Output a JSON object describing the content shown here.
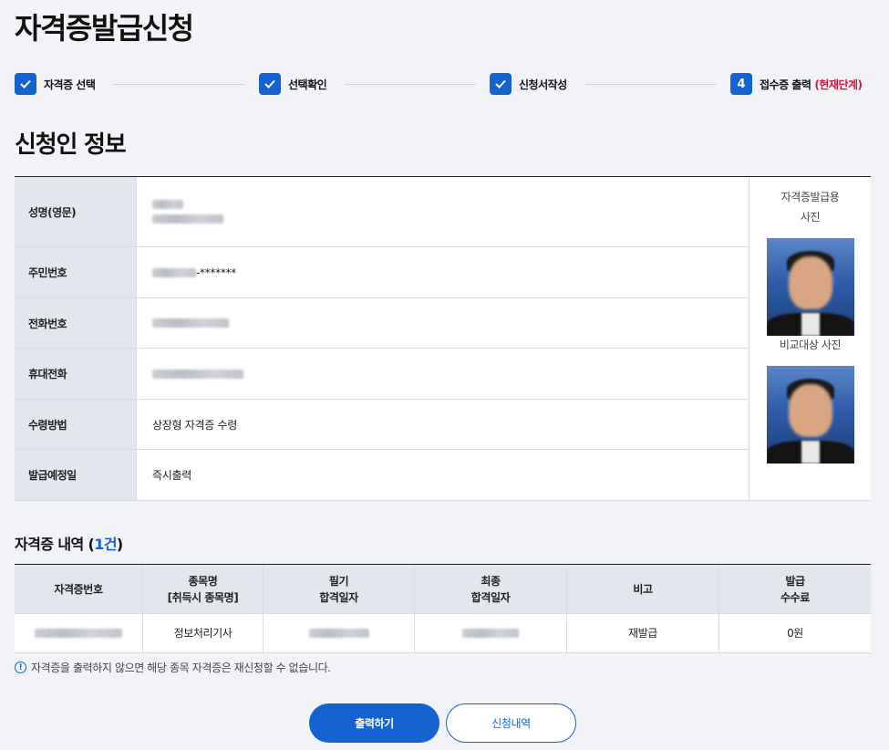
{
  "page": {
    "title": "자격증발급신청"
  },
  "stepper": {
    "steps": [
      {
        "label": "자격증 선택",
        "state": "done"
      },
      {
        "label": "선택확인",
        "state": "done"
      },
      {
        "label": "신청서작성",
        "state": "done"
      },
      {
        "number": "4",
        "label": "접수증 출력",
        "current_tag": "(현재단계)",
        "state": "current"
      }
    ],
    "check_icon": "check-icon"
  },
  "applicant": {
    "section_title": "신청인 정보",
    "rows": [
      {
        "label": "성명(영문)",
        "value": ""
      },
      {
        "label": "주민번호",
        "value_suffix": "-*******"
      },
      {
        "label": "전화번호",
        "value": ""
      },
      {
        "label": "휴대전화",
        "value": ""
      },
      {
        "label": "수령방법",
        "value": "상장형 자격증 수령"
      },
      {
        "label": "발급예정일",
        "value": "즉시출력"
      }
    ],
    "photo_label_line1": "자격증발급용",
    "photo_label_line2": "사진",
    "compare_photo_label": "비교대상 사진"
  },
  "certificates": {
    "title_prefix": "자격증 내역 (",
    "count": "1건",
    "title_suffix": ")",
    "columns": [
      {
        "line1": "자격증번호",
        "line2": ""
      },
      {
        "line1": "종목명",
        "line2": "[취득시 종목명]"
      },
      {
        "line1": "필기",
        "line2": "합격일자"
      },
      {
        "line1": "최종",
        "line2": "합격일자"
      },
      {
        "line1": "비고",
        "line2": ""
      },
      {
        "line1": "발급",
        "line2": "수수료"
      }
    ],
    "rows": [
      {
        "cert_no": "",
        "item_name": "정보처리기사",
        "written_date": "",
        "final_date": "",
        "note": "재발급",
        "fee": "0원"
      }
    ]
  },
  "notice": {
    "icon": "exclamation-circle-icon",
    "text": "자격증을 출력하지 않으면 해당 종목 자격증은 재신청할 수 없습니다."
  },
  "buttons": {
    "print": "출력하기",
    "history": "신청내역"
  },
  "colors": {
    "accent": "#1463d0",
    "current_step": "#d3163a",
    "header_bg": "#e2e6ed",
    "page_bg": "#f1f3f7"
  }
}
